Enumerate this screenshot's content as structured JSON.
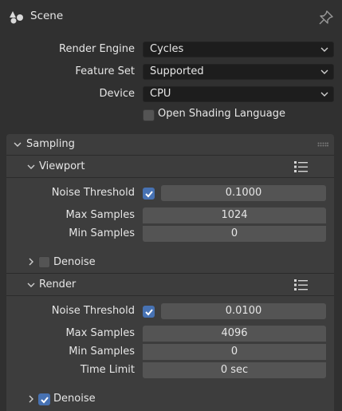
{
  "header": {
    "title": "Scene",
    "icon": "scene-icon",
    "pin_icon": "pin-icon"
  },
  "render_settings": {
    "render_engine": {
      "label": "Render Engine",
      "value": "Cycles"
    },
    "feature_set": {
      "label": "Feature Set",
      "value": "Supported"
    },
    "device": {
      "label": "Device",
      "value": "CPU"
    },
    "osl": {
      "label": "Open Shading Language",
      "checked": false
    }
  },
  "sampling": {
    "title": "Sampling",
    "viewport": {
      "title": "Viewport",
      "noise_threshold": {
        "label": "Noise Threshold",
        "checked": true,
        "value": "0.1000"
      },
      "max_samples": {
        "label": "Max Samples",
        "value": "1024"
      },
      "min_samples": {
        "label": "Min Samples",
        "value": "0"
      },
      "denoise": {
        "label": "Denoise",
        "checked": false
      }
    },
    "render": {
      "title": "Render",
      "noise_threshold": {
        "label": "Noise Threshold",
        "checked": true,
        "value": "0.0100"
      },
      "max_samples": {
        "label": "Max Samples",
        "value": "4096"
      },
      "min_samples": {
        "label": "Min Samples",
        "value": "0"
      },
      "time_limit": {
        "label": "Time Limit",
        "value": "0 sec"
      },
      "denoise": {
        "label": "Denoise",
        "checked": true
      }
    }
  },
  "colors": {
    "accent": "#4772b3",
    "panel": "#3d3d3d",
    "background": "#303030",
    "field": "#545454",
    "dropdown": "#1d1d1d"
  }
}
